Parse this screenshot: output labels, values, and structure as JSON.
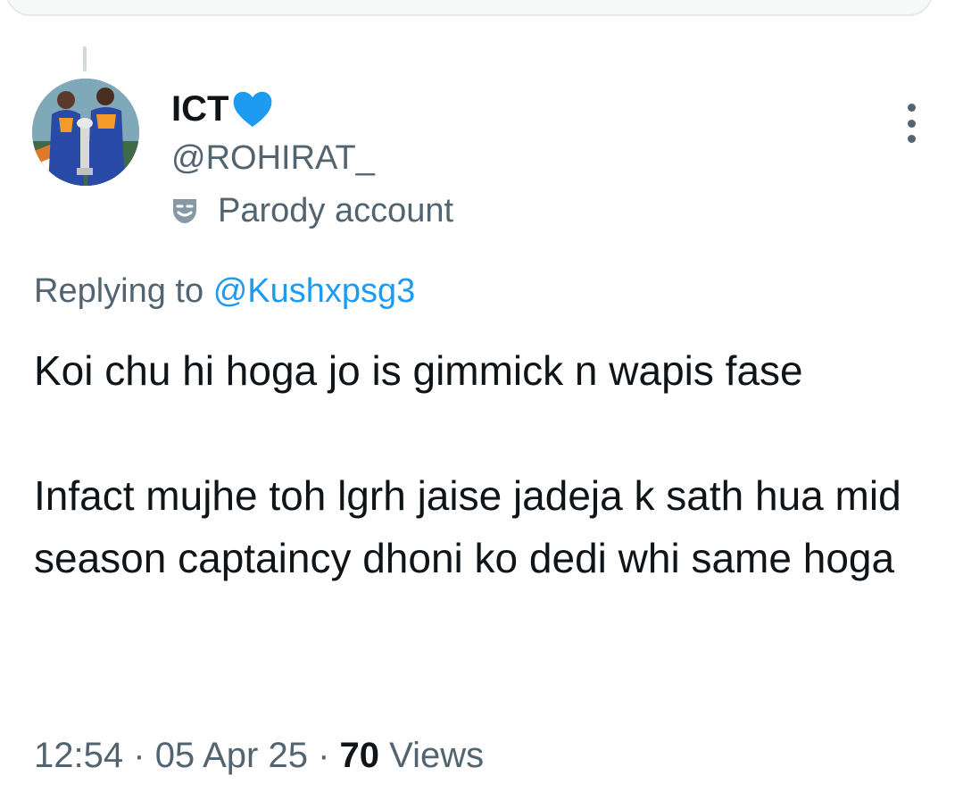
{
  "tweet": {
    "author": {
      "display_name": "ICT",
      "name_badge_icon": "blue-heart-icon",
      "handle": "@ROHIRAT_",
      "label_icon": "parody-mask-icon",
      "label": "Parody account"
    },
    "more_icon": "more-vertical-icon",
    "replying_prefix": "Replying to",
    "replying_to": "@Kushxpsg3",
    "text_paragraphs": [
      "Koi chu hi hoga jo is gimmick n wapis fase",
      "Infact mujhe toh lgrh jaise jadeja k sath hua mid season captaincy dhoni ko dedi whi same hoga"
    ],
    "time": "12:54",
    "separator": "·",
    "date": "05 Apr 25",
    "views_count": "70",
    "views_label": "Views"
  },
  "colors": {
    "primary_text": "#0f1419",
    "secondary_text": "#536471",
    "link": "#1d9bf0",
    "heart": "#1d9bf0"
  }
}
